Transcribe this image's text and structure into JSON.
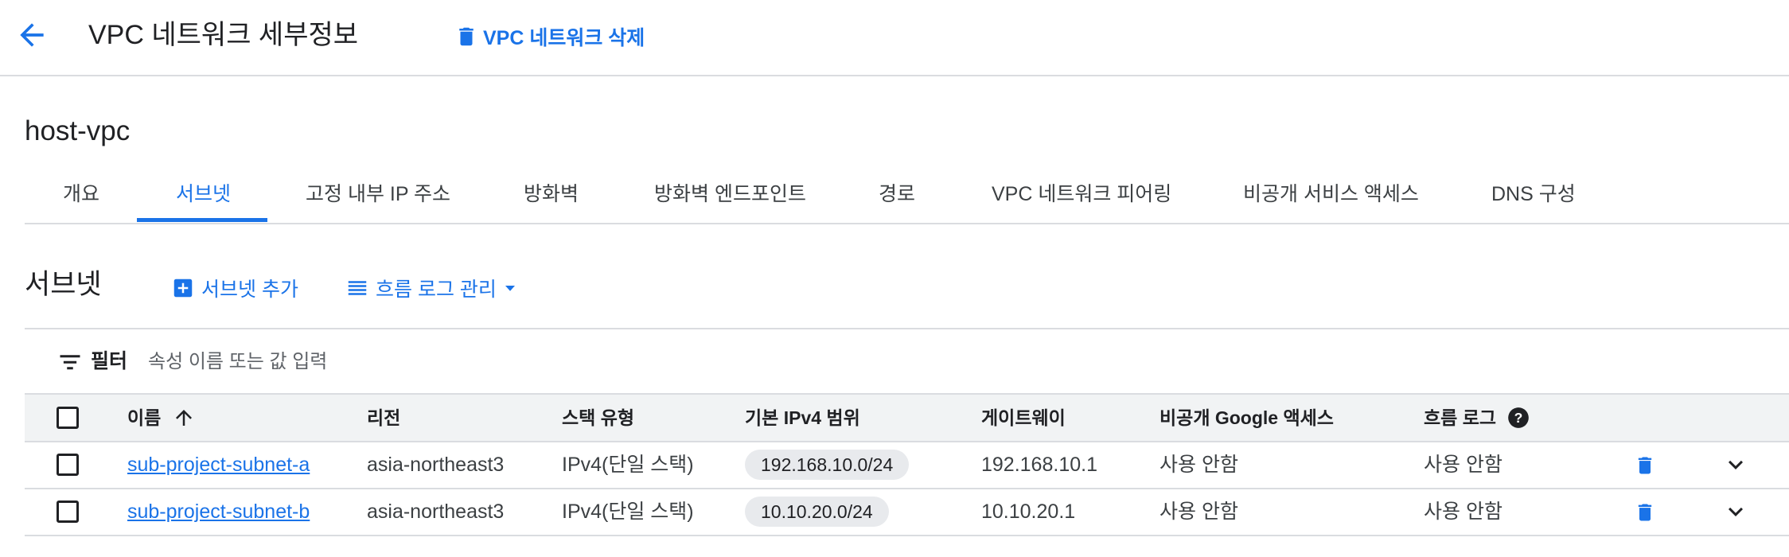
{
  "header": {
    "title": "VPC 네트워크 세부정보",
    "delete_label": "VPC 네트워크 삭제"
  },
  "network": {
    "name": "host-vpc"
  },
  "tabs": [
    {
      "label": "개요"
    },
    {
      "label": "서브넷",
      "active": true
    },
    {
      "label": "고정 내부 IP 주소"
    },
    {
      "label": "방화벽"
    },
    {
      "label": "방화벽 엔드포인트"
    },
    {
      "label": "경로"
    },
    {
      "label": "VPC 네트워크 피어링"
    },
    {
      "label": "비공개 서비스 액세스"
    },
    {
      "label": "DNS 구성"
    }
  ],
  "subnets_section": {
    "title": "서브넷",
    "add_label": "서브넷 추가",
    "flow_logs_label": "흐름 로그 관리"
  },
  "filter": {
    "label": "필터",
    "placeholder": "속성 이름 또는 값 입력"
  },
  "table": {
    "columns": {
      "name": "이름",
      "region": "리전",
      "stack": "스택 유형",
      "ipv4": "기본 IPv4 범위",
      "gateway": "게이트웨이",
      "google_access": "비공개 Google 액세스",
      "flow_logs": "흐름 로그"
    },
    "sort": {
      "column": "name",
      "direction": "ascending"
    },
    "rows": [
      {
        "name": "sub-project-subnet-a",
        "region": "asia-northeast3",
        "stack": "IPv4(단일 스택)",
        "ipv4": "192.168.10.0/24",
        "gateway": "192.168.10.1",
        "google_access": "사용 안함",
        "flow_logs": "사용 안함"
      },
      {
        "name": "sub-project-subnet-b",
        "region": "asia-northeast3",
        "stack": "IPv4(단일 스택)",
        "ipv4": "10.10.20.0/24",
        "gateway": "10.10.20.1",
        "google_access": "사용 안함",
        "flow_logs": "사용 안함"
      }
    ]
  },
  "colors": {
    "accent": "#1a73e8",
    "header_bg": "#f1f3f4",
    "divider": "#dadce0",
    "chip_bg": "#e8eaed"
  },
  "icons": {
    "back": "arrow-back-icon",
    "delete": "trash-icon",
    "add": "add-box-icon",
    "flow_logs": "list-icon",
    "dropdown": "caret-down-icon",
    "filter": "filter-icon",
    "sort": "arrow-up-icon",
    "help": "help-icon",
    "expand": "chevron-down-icon"
  }
}
